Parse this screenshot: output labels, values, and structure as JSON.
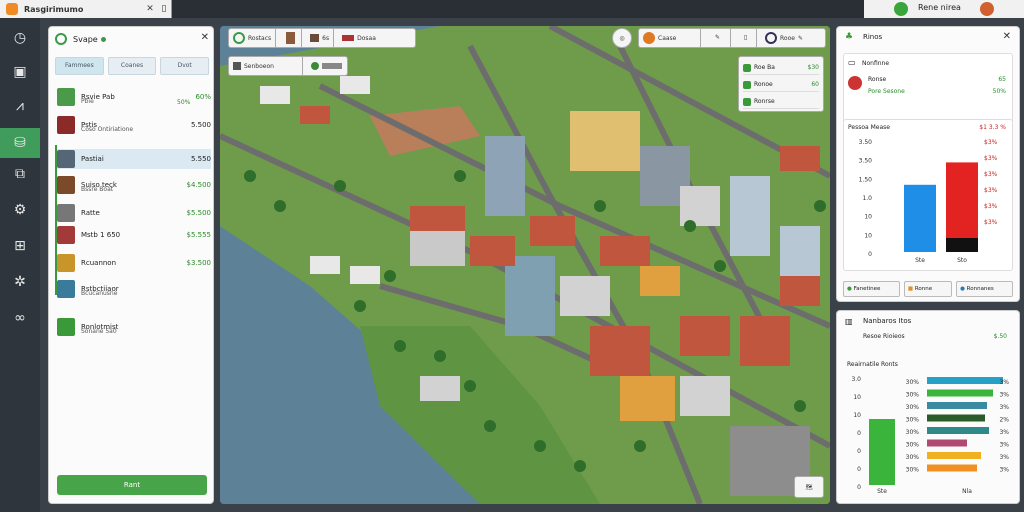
{
  "app": {
    "title": "Rasgirimumo"
  },
  "topbar": {
    "user": "Rene nirea"
  },
  "left_panel": {
    "title": "Svape",
    "tabs": [
      "Fammees",
      "Coanes",
      "Dvot"
    ],
    "rows": [
      {
        "name": "Rsvie Pab",
        "sub": "Pbie",
        "value": "60%",
        "value2": "50%",
        "color": "#4a9a4a"
      },
      {
        "name": "Pstis",
        "sub": "Coso Ontiriatione",
        "value": "5.500",
        "color": "#8c2a2a"
      },
      {
        "name": "Pastiai",
        "sub": "",
        "value": "5.550",
        "color": "#556677"
      },
      {
        "name": "Suiso teck",
        "sub": "Bssre Boat",
        "value": "$4.500",
        "color": "#7a4a2a"
      },
      {
        "name": "Ratte",
        "sub": "",
        "value": "$5.500",
        "color": "#777777"
      },
      {
        "name": "Mstb 1 650",
        "sub": "",
        "value": "$5.555",
        "color": "#a33a3a"
      },
      {
        "name": "Rcuannon",
        "sub": "",
        "value": "$3.500",
        "color": "#c7952a"
      },
      {
        "name": "Rstbctiiaor",
        "sub": "Bcucanusne",
        "value": "",
        "color": "#3a7a9a"
      },
      {
        "name": "Ronlotmist",
        "sub": "Sonane 5a0",
        "value": "",
        "color": "#3a9a3a"
      }
    ],
    "button": "Rant"
  },
  "map_toolbar": {
    "left": [
      {
        "label": "Rostacs"
      },
      {
        "label": ""
      },
      {
        "label": "6s"
      },
      {
        "label": "Dosaa"
      }
    ],
    "sub": [
      {
        "label": "Senboeon"
      },
      {
        "label": ""
      }
    ],
    "right": [
      {
        "label": ""
      },
      {
        "label": "Caase"
      },
      {
        "label": ""
      },
      {
        "label": ""
      },
      {
        "label": "Rooe"
      }
    ],
    "info": [
      {
        "label": "Roe Ba",
        "value": "$30"
      },
      {
        "label": "Ronoe",
        "value": "60"
      },
      {
        "label": "Ronrse",
        "value": ""
      }
    ],
    "corner_button": "🗺"
  },
  "right_top": {
    "title": "Rinos",
    "item_title": "Nonfinne",
    "item_rows": [
      {
        "label": "Ronse",
        "value": "65"
      },
      {
        "label": "Pore Sesone",
        "value": "50%"
      }
    ],
    "chart_title": "Pessoa Mease",
    "chart_value": "$1 3.3 %",
    "buttons": [
      "Fanetinee",
      "Ronne",
      "Ronnanes"
    ]
  },
  "right_bottom": {
    "title": "Nanbaros Itos",
    "sub": "Resoe Rioieos",
    "sub_value": "$.50",
    "chart_title": "Reairnatile Ronts"
  },
  "chart_data": [
    {
      "type": "bar",
      "title": "Pessoa Mease",
      "categories": [
        "Ste",
        "Sto"
      ],
      "series": [
        {
          "values": [
            300,
            400
          ]
        }
      ],
      "colors": [
        "#1f8ee6",
        "#e32222"
      ],
      "yticks": [
        "3.50",
        "3.50",
        "1.50",
        "1.0",
        "10",
        "10",
        "0"
      ],
      "right_labels": [
        "$3%",
        "$3%",
        "$3%",
        "$3%",
        "$3%",
        "$3%"
      ],
      "ylim": [
        0,
        500
      ]
    },
    {
      "type": "bar",
      "title": "Reairnatile Ronts",
      "categories": [
        "Ste",
        "Nla"
      ],
      "series": [
        {
          "values": [
            300
          ]
        },
        {
          "values": [
            3.8,
            3.3,
            3.0,
            2.9,
            3.1,
            2.0,
            2.7,
            2.5
          ]
        }
      ],
      "colors": [
        "#3ab43a",
        "#27a0c8",
        "#3ab43a",
        "#3a8aa0",
        "#2a5a2a",
        "#2e8a8a",
        "#b04a70",
        "#f0b020",
        "#f09020"
      ],
      "yticks": [
        "3.0",
        "10",
        "10",
        "0",
        "0",
        "0",
        "0"
      ],
      "mid_labels": [
        "30%",
        "30%",
        "30%",
        "30%",
        "30%",
        "30%",
        "30%",
        "30%"
      ],
      "right_labels": [
        "3%",
        "3%",
        "3%",
        "2%",
        "3%",
        "3%",
        "3%",
        "3%"
      ]
    }
  ]
}
